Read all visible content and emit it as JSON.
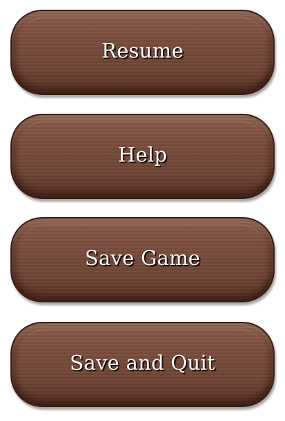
{
  "pause_menu": {
    "buttons": [
      {
        "id": "resume",
        "label": "Resume"
      },
      {
        "id": "help",
        "label": "Help"
      },
      {
        "id": "save_game",
        "label": "Save Game"
      },
      {
        "id": "save_and_quit",
        "label": "Save and Quit"
      }
    ]
  },
  "colors": {
    "wood_light": "#8a5b4a",
    "wood_dark": "#5b3529",
    "border": "#3a1f12",
    "label": "#ffffff",
    "label_shadow": "#1a0c06"
  }
}
